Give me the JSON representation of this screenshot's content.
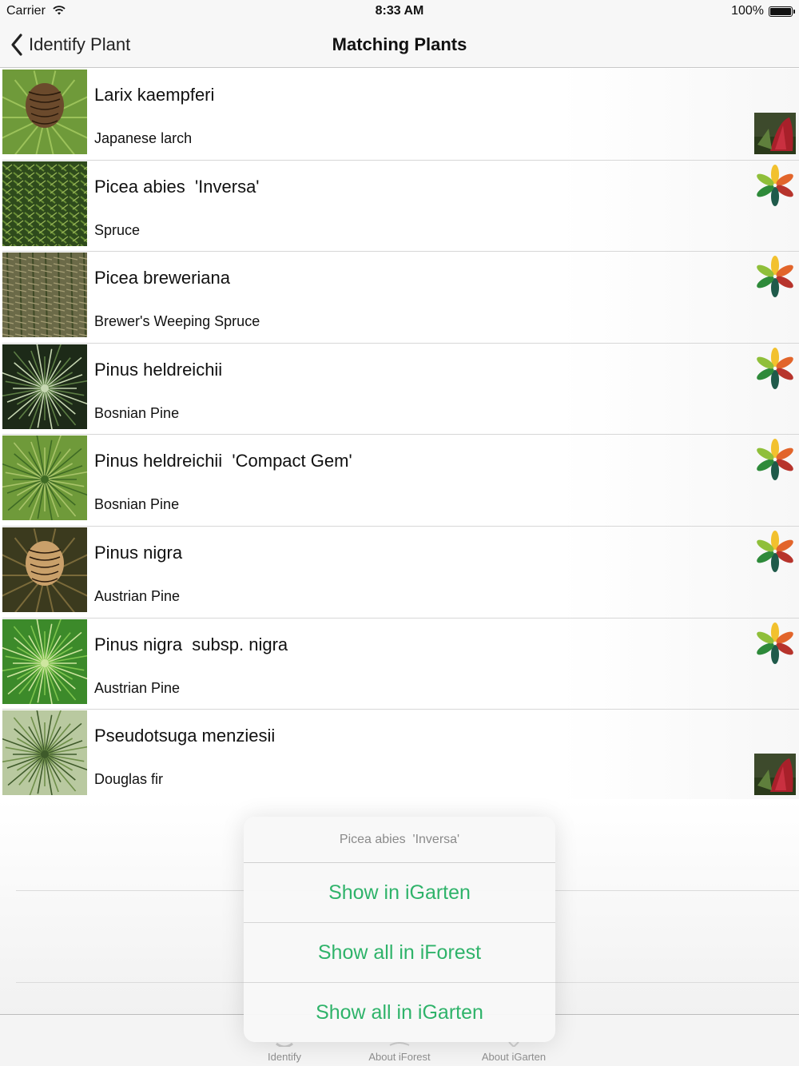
{
  "status_bar": {
    "carrier": "Carrier",
    "time": "8:33 AM",
    "battery": "100%"
  },
  "nav": {
    "back_label": "Identify Plant",
    "title": "Matching Plants"
  },
  "plants": [
    {
      "scientific": "Larix kaempferi",
      "common": "Japanese larch",
      "badge": "igarten-photo-icon",
      "thumb": "larch-cone"
    },
    {
      "scientific": "Picea abies  'Inversa'",
      "common": "Spruce",
      "badge": "iforest-flower-icon",
      "thumb": "spruce"
    },
    {
      "scientific": "Picea breweriana",
      "common": "Brewer's Weeping Spruce",
      "badge": "iforest-flower-icon",
      "thumb": "weeping-spruce"
    },
    {
      "scientific": "Pinus heldreichii",
      "common": "Bosnian Pine",
      "badge": "iforest-flower-icon",
      "thumb": "pine-needles"
    },
    {
      "scientific": "Pinus heldreichii  'Compact Gem'",
      "common": "Bosnian Pine",
      "badge": "iforest-flower-icon",
      "thumb": "pine-light"
    },
    {
      "scientific": "Pinus nigra",
      "common": "Austrian Pine",
      "badge": "iforest-flower-icon",
      "thumb": "pine-cone"
    },
    {
      "scientific": "Pinus nigra  subsp. nigra",
      "common": "Austrian Pine",
      "badge": "iforest-flower-icon",
      "thumb": "pine-bright"
    },
    {
      "scientific": "Pseudotsuga menziesii",
      "common": "Douglas fir",
      "badge": "igarten-photo-icon",
      "thumb": "douglas-fir"
    }
  ],
  "action_sheet": {
    "title": "Picea abies  'Inversa'",
    "buttons": [
      "Show in iGarten",
      "Show all in iForest",
      "Show all in iGarten"
    ],
    "button_color": "#2fb36a"
  },
  "tab_bar": {
    "items": [
      {
        "label": "Identify",
        "icon": "identify-icon"
      },
      {
        "label": "About iForest",
        "icon": "iforest-icon"
      },
      {
        "label": "About iGarten",
        "icon": "igarten-icon"
      }
    ]
  }
}
